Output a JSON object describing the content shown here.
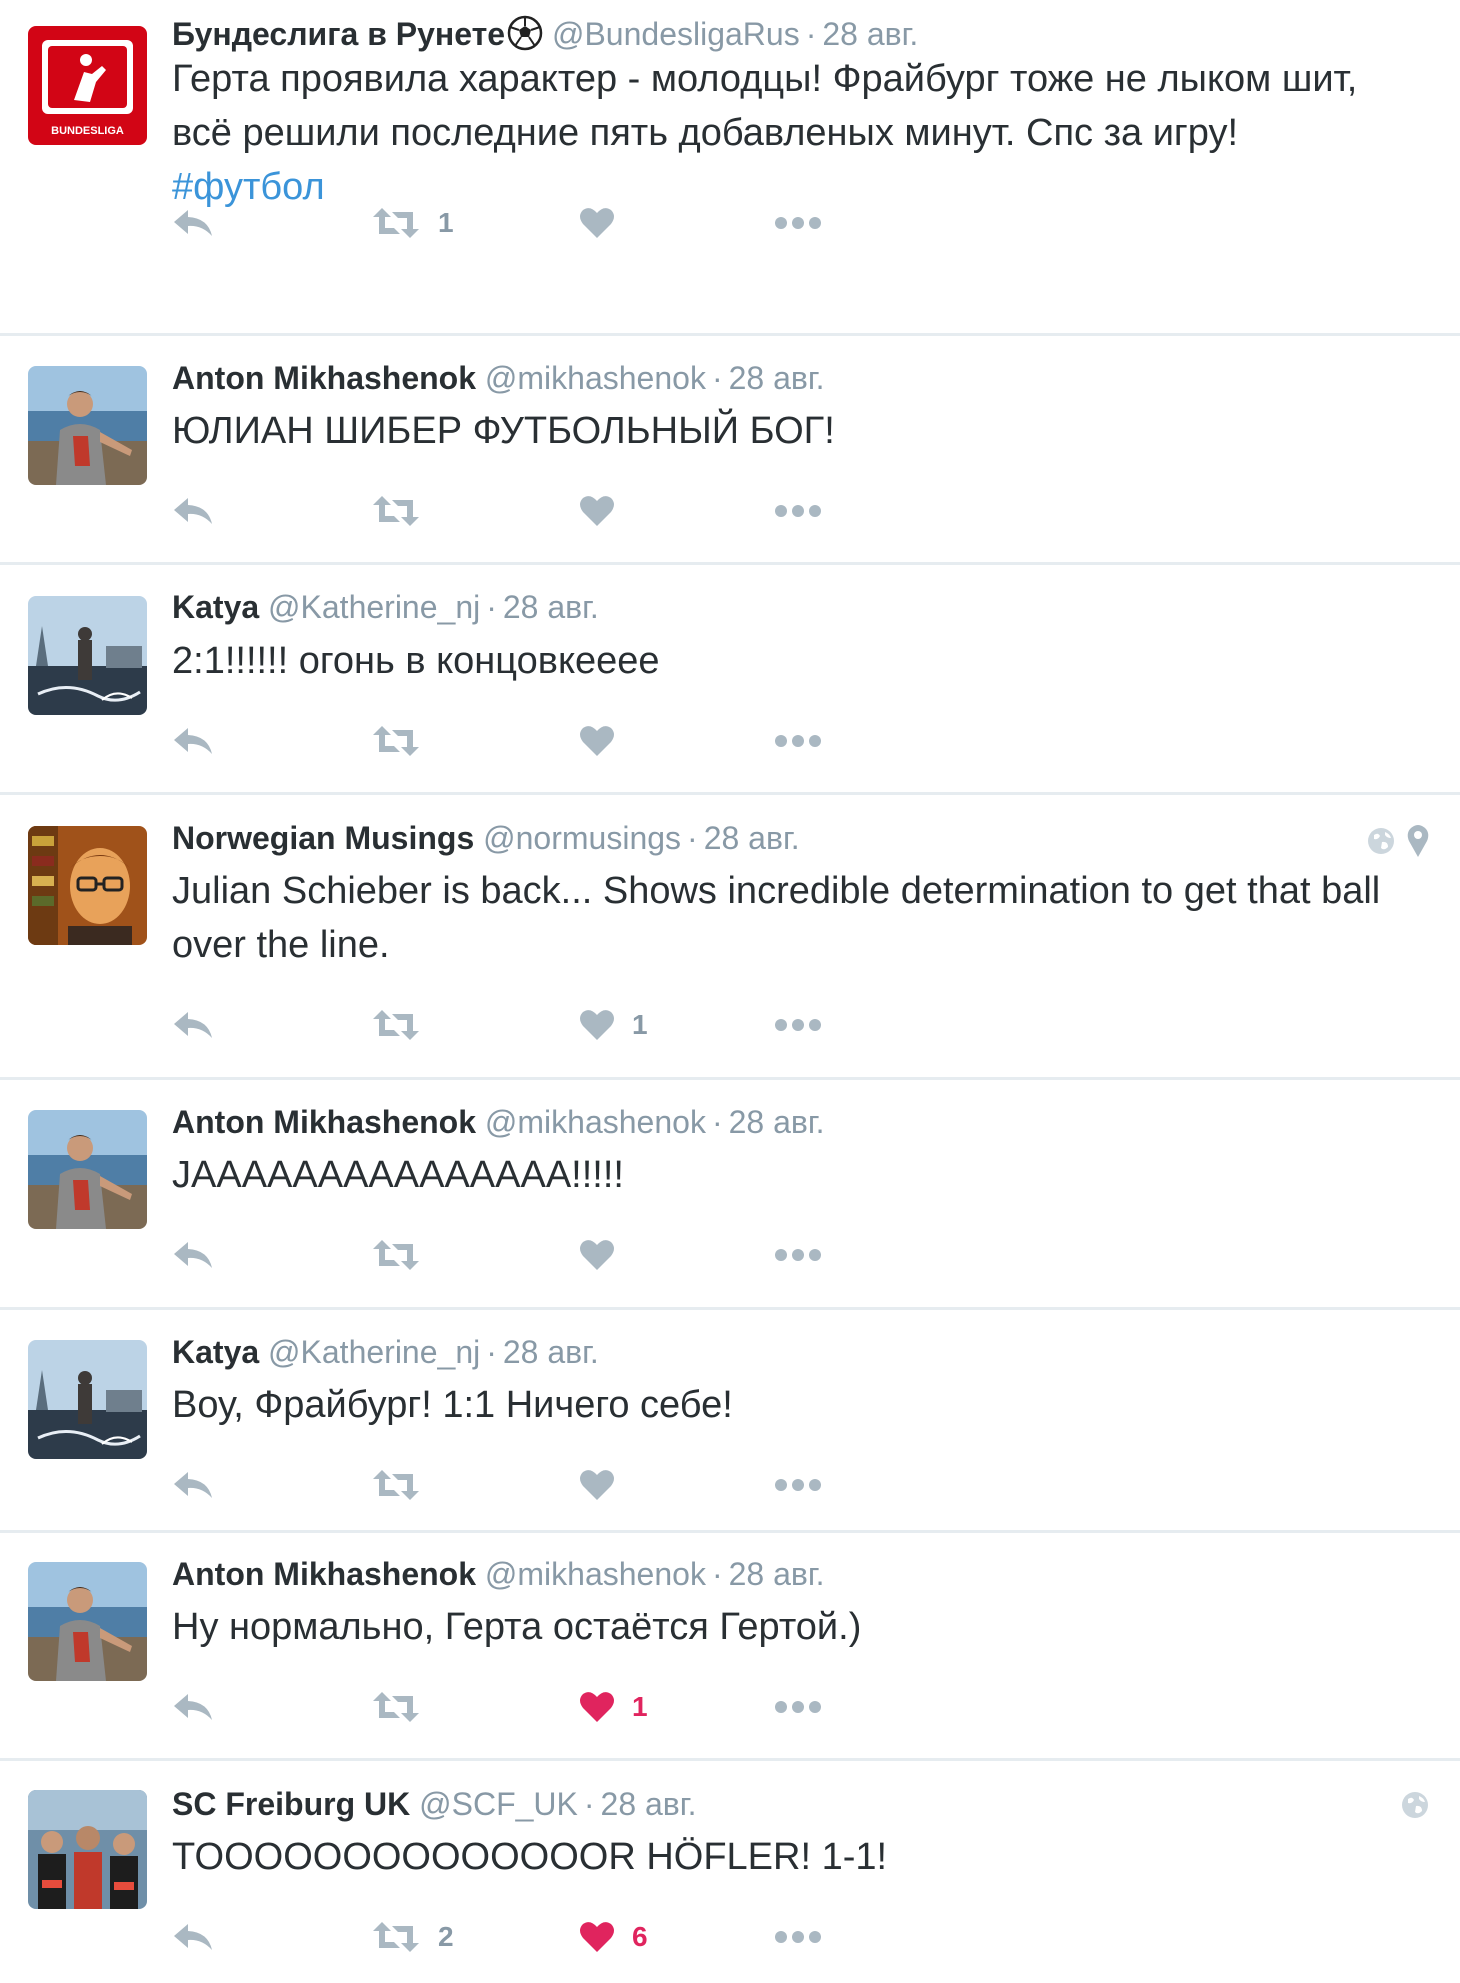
{
  "colors": {
    "name": "#292f33",
    "meta": "#8899a6",
    "hashtag": "#3b94d9",
    "liked": "#e0245e",
    "action": "#aab8c2",
    "separator": "#e6ecf0"
  },
  "tweets": [
    {
      "name": "Бундеслига в Рунете",
      "handle": "@BundesligaRus",
      "time": "28 авг.",
      "text": "Герта проявила характер - молодцы! Фрайбург тоже не лыком шит, всё решили последние пять добавленых минут. Спс за игру!",
      "hashtag": "#футбол",
      "retweets": "1",
      "likes": "",
      "liked": false,
      "name_icon": "soccer-ball-icon",
      "avatar": "bundesliga-logo",
      "avatar_text": "BUNDESLIGA"
    },
    {
      "name": "Anton Mikhashenok",
      "handle": "@mikhashenok",
      "time": "28 авг.",
      "text": "ЮЛИАН ШИБЕР ФУТБОЛЬНЫЙ БОГ!",
      "retweets": "",
      "likes": "",
      "liked": false,
      "avatar": "man-by-sea-photo"
    },
    {
      "name": "Katya",
      "handle": "@Katherine_nj",
      "time": "28 авг.",
      "text": "2:1!!!!!! огонь в концовкееее",
      "retweets": "",
      "likes": "",
      "liked": false,
      "avatar": "paris-photo"
    },
    {
      "name": "Norwegian Musings",
      "handle": "@normusings",
      "time": "28 авг.",
      "text": "Julian Schieber is back... Shows incredible determination to get that ball over the line.",
      "retweets": "",
      "likes": "1",
      "liked": false,
      "meta_icons": [
        "globe-icon",
        "location-pin-icon"
      ],
      "avatar": "man-glasses-photo"
    },
    {
      "name": "Anton Mikhashenok",
      "handle": "@mikhashenok",
      "time": "28 авг.",
      "text": "JAAAAAAAAAAAAAAA!!!!!",
      "retweets": "",
      "likes": "",
      "liked": false,
      "avatar": "man-by-sea-photo"
    },
    {
      "name": "Katya",
      "handle": "@Katherine_nj",
      "time": "28 авг.",
      "text": "Воу, Фрайбург! 1:1 Ничего себе!",
      "retweets": "",
      "likes": "",
      "liked": false,
      "avatar": "paris-photo"
    },
    {
      "name": "Anton Mikhashenok",
      "handle": "@mikhashenok",
      "time": "28 авг.",
      "text": "Ну нормально, Герта остаётся Гертой.)",
      "retweets": "",
      "likes": "1",
      "liked": true,
      "avatar": "man-by-sea-photo"
    },
    {
      "name": "SC Freiburg UK",
      "handle": "@SCF_UK",
      "time": "28 авг.",
      "text": "TOOOOOOOOOOOOOOR HÖFLER! 1-1!",
      "retweets": "2",
      "likes": "6",
      "liked": true,
      "meta_icons": [
        "globe-icon"
      ],
      "avatar": "fans-photo"
    }
  ]
}
